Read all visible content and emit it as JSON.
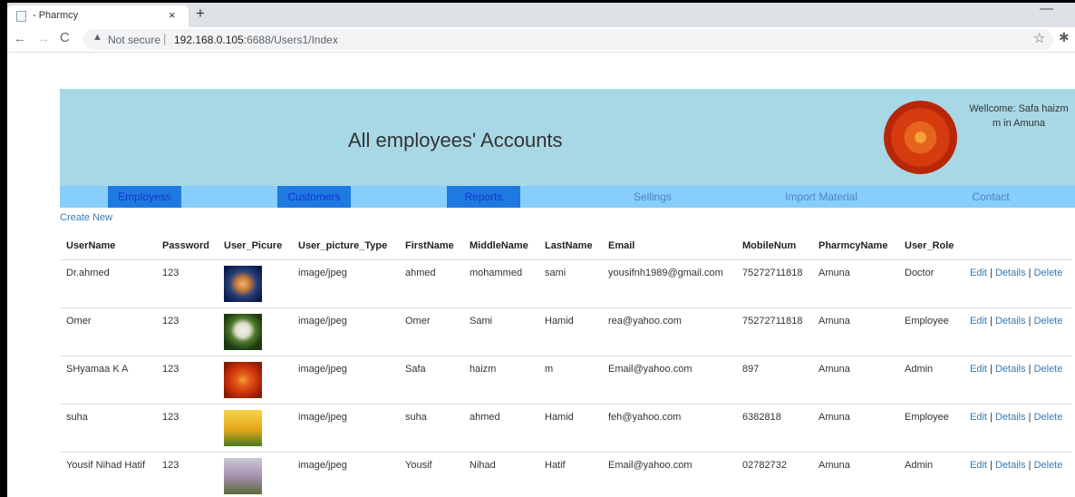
{
  "browser": {
    "tab_title": "- Pharmcy",
    "tab_close": "×",
    "new_tab": "+",
    "minimize": "—",
    "back": "←",
    "forward": "→",
    "reload": "C",
    "warning_icon": "▲",
    "security_label": "Not secure",
    "separator": "|",
    "url_host": "192.168.0.105",
    "url_path": ":6688/Users1/Index",
    "bookmark_icon": "☆",
    "extensions_icon": "✱"
  },
  "header": {
    "title": "All employees' Accounts",
    "welcome": "Wellcome: Safa haizm m in Amuna"
  },
  "nav": {
    "items": [
      "Employess",
      "Customers",
      "Reports",
      "Sellings",
      "Import Material",
      "Contact"
    ]
  },
  "create_new": "Create New",
  "table": {
    "headers": [
      "UserName",
      "Password",
      "User_Picure",
      "User_picture_Type",
      "FirstName",
      "MiddleName",
      "LastName",
      "Email",
      "MobileNum",
      "PharmcyName",
      "User_Role",
      ""
    ],
    "rows": [
      {
        "username": "Dr.ahmed",
        "password": "123",
        "picture": "jellyfish",
        "type": "image/jpeg",
        "first": "ahmed",
        "middle": "mohammed",
        "last": "sami",
        "email": "yousifnh1989@gmail.com",
        "mobile": "75272711818",
        "pharmacy": "Amuna",
        "role": "Doctor"
      },
      {
        "username": "Omer",
        "password": "123",
        "picture": "white-flower",
        "type": "image/jpeg",
        "first": "Omer",
        "middle": "Sami",
        "last": "Hamid",
        "email": "rea@yahoo.com",
        "mobile": "75272711818",
        "pharmacy": "Amuna",
        "role": "Employee"
      },
      {
        "username": "SHyamaa K A",
        "password": "123",
        "picture": "red-chrysanthemum",
        "type": "image/jpeg",
        "first": "Safa",
        "middle": "haizm",
        "last": "m",
        "email": "Email@yahoo.com",
        "mobile": "897",
        "pharmacy": "Amuna",
        "role": "Admin"
      },
      {
        "username": "suha",
        "password": "123",
        "picture": "tulips",
        "type": "image/jpeg",
        "first": "suha",
        "middle": "ahmed",
        "last": "Hamid",
        "email": "feh@yahoo.com",
        "mobile": "6382818",
        "pharmacy": "Amuna",
        "role": "Employee"
      },
      {
        "username": "Yousif Nihad Hatif",
        "password": "123",
        "picture": "blossom-tree",
        "type": "image/jpeg",
        "first": "Yousif",
        "middle": "Nihad",
        "last": "Hatif",
        "email": "Email@yahoo.com",
        "mobile": "02782732",
        "pharmacy": "Amuna",
        "role": "Admin"
      }
    ],
    "actions": {
      "edit": "Edit",
      "details": "Details",
      "delete": "Delete",
      "separator": "|"
    }
  }
}
